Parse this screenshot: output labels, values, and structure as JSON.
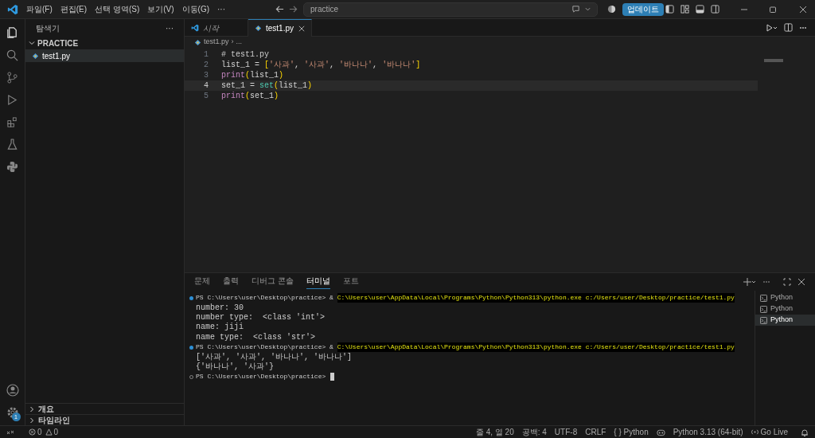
{
  "menu": [
    "파일(F)",
    "편집(E)",
    "선택 영역(S)",
    "보기(V)",
    "이동(G)",
    "···"
  ],
  "search": {
    "value": "practice"
  },
  "update_button": "업데이트",
  "sidebar": {
    "title": "탐색기",
    "more": "···",
    "folder": {
      "label": "PRACTICE",
      "expanded": true,
      "files": [
        {
          "name": "test1.py",
          "selected": true
        }
      ]
    },
    "sections": [
      {
        "label": "개요",
        "expanded": false
      },
      {
        "label": "타임라인",
        "expanded": false
      }
    ]
  },
  "settings_badge": "1",
  "tabs": [
    {
      "label": "시작",
      "selected": false,
      "kind": "welcome"
    },
    {
      "label": "test1.py",
      "selected": true,
      "kind": "python"
    }
  ],
  "breadcrumb": [
    "test1.py",
    "›",
    "..."
  ],
  "code": [
    {
      "number": "1",
      "current": false,
      "tokens": [
        {
          "t": "# test1.py",
          "kind": "comment"
        }
      ]
    },
    {
      "number": "2",
      "current": false,
      "tokens": [
        {
          "t": "list_1 = ",
          "kind": "plain"
        },
        {
          "t": "[",
          "kind": "bracket"
        },
        {
          "t": "'사과'",
          "kind": "string"
        },
        {
          "t": ", ",
          "kind": "plain"
        },
        {
          "t": "'사과'",
          "kind": "string"
        },
        {
          "t": ", ",
          "kind": "plain"
        },
        {
          "t": "'바나나'",
          "kind": "string"
        },
        {
          "t": ", ",
          "kind": "plain"
        },
        {
          "t": "'바나나'",
          "kind": "string"
        },
        {
          "t": "]",
          "kind": "bracket"
        }
      ]
    },
    {
      "number": "3",
      "current": false,
      "tokens": [
        {
          "t": "print",
          "kind": "func"
        },
        {
          "t": "(",
          "kind": "bracket"
        },
        {
          "t": "list_1",
          "kind": "plain"
        },
        {
          "t": ")",
          "kind": "bracket"
        }
      ]
    },
    {
      "number": "4",
      "current": true,
      "tokens": [
        {
          "t": "set_1 = ",
          "kind": "plain"
        },
        {
          "t": "set",
          "kind": "builtin"
        },
        {
          "t": "(",
          "kind": "bracket"
        },
        {
          "t": "list_1",
          "kind": "plain"
        },
        {
          "t": ")",
          "kind": "bracket"
        }
      ]
    },
    {
      "number": "5",
      "current": false,
      "tokens": [
        {
          "t": "print",
          "kind": "func"
        },
        {
          "t": "(",
          "kind": "bracket"
        },
        {
          "t": "set_1",
          "kind": "plain"
        },
        {
          "t": ")",
          "kind": "bracket"
        }
      ]
    }
  ],
  "panel_tabs": [
    {
      "label": "문제",
      "selected": false
    },
    {
      "label": "출력",
      "selected": false
    },
    {
      "label": "디버그 콘솔",
      "selected": false
    },
    {
      "label": "터미널",
      "selected": true
    },
    {
      "label": "포트",
      "selected": false
    }
  ],
  "terminal": [
    {
      "kind": "prompt",
      "succeeded": true,
      "prompt": "PS C:\\Users\\user\\Desktop\\practice> & ",
      "command": "C:\\Users\\user\\AppData\\Local\\Programs\\Python\\Python313\\python.exe c:/Users/user/Desktop/practice/test1.py"
    },
    {
      "kind": "output",
      "text": "number: 30"
    },
    {
      "kind": "output",
      "text": "number type:  <class 'int'>"
    },
    {
      "kind": "output",
      "text": "name: jiji"
    },
    {
      "kind": "output",
      "text": "name type:  <class 'str'>"
    },
    {
      "kind": "prompt",
      "succeeded": true,
      "prompt": "PS C:\\Users\\user\\Desktop\\practice> & ",
      "command": "C:\\Users\\user\\AppData\\Local\\Programs\\Python\\Python313\\python.exe c:/Users/user/Desktop/practice/test1.py"
    },
    {
      "kind": "output",
      "text": "['사과', '사과', '바나나', '바나나']"
    },
    {
      "kind": "output",
      "text": "{'바나나', '사과'}"
    },
    {
      "kind": "prompt",
      "succeeded": false,
      "prompt": "PS C:\\Users\\user\\Desktop\\practice> ",
      "cursor": true
    }
  ],
  "terminals": [
    {
      "label": "Python",
      "selected": false
    },
    {
      "label": "Python",
      "selected": false
    },
    {
      "label": "Python",
      "selected": true
    }
  ],
  "status_bar": {
    "errors": "0",
    "warnings": "0",
    "items": [
      "줄 4, 열 20",
      "공백: 4",
      "UTF-8",
      "CRLF",
      "{ } Python"
    ],
    "interpreter": "Python 3.13 (64-bit)",
    "go_live": "Go Live"
  }
}
